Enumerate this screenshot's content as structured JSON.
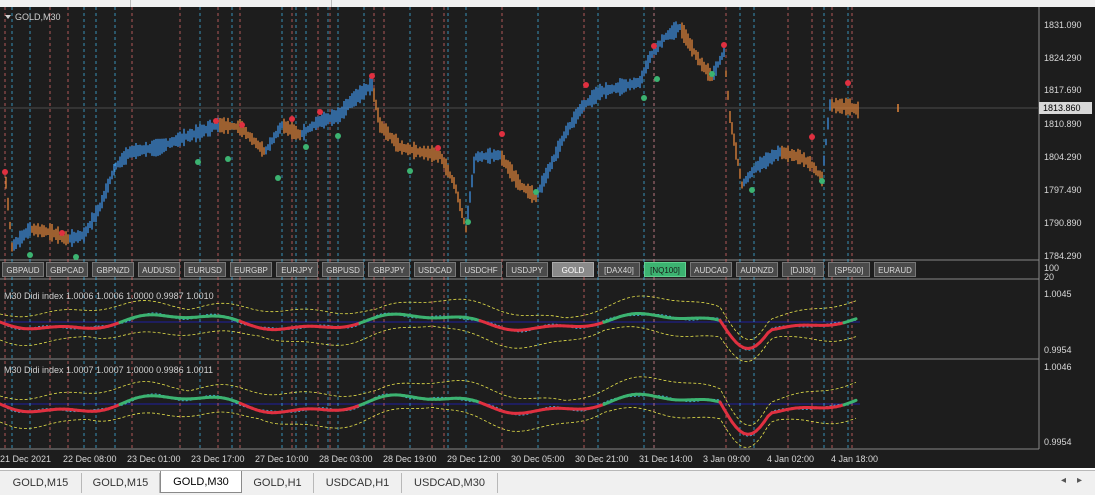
{
  "window": {
    "symbol_title": "GOLD,M30"
  },
  "price_axis": {
    "labels": [
      "1831.090",
      "1824.290",
      "1817.690",
      "1810.890",
      "1804.290",
      "1797.490",
      "1790.890",
      "1784.290"
    ],
    "current_price": "1813.860"
  },
  "symbol_buttons": [
    {
      "label": "GBPAUD",
      "state": "normal"
    },
    {
      "label": "GBPCAD",
      "state": "normal"
    },
    {
      "label": "GBPNZD",
      "state": "normal"
    },
    {
      "label": "AUDUSD",
      "state": "normal"
    },
    {
      "label": "EURUSD",
      "state": "normal"
    },
    {
      "label": "EURGBP",
      "state": "normal"
    },
    {
      "label": "EURJPY",
      "state": "normal"
    },
    {
      "label": "GBPUSD",
      "state": "normal"
    },
    {
      "label": "GBPJPY",
      "state": "normal"
    },
    {
      "label": "USDCAD",
      "state": "normal"
    },
    {
      "label": "USDCHF",
      "state": "normal"
    },
    {
      "label": "USDJPY",
      "state": "normal"
    },
    {
      "label": "GOLD",
      "state": "active"
    },
    {
      "label": "[DAX40]",
      "state": "normal"
    },
    {
      "label": "[NQ100]",
      "state": "green"
    },
    {
      "label": "AUDCAD",
      "state": "normal"
    },
    {
      "label": "AUDNZD",
      "state": "normal"
    },
    {
      "label": "[DJI30]",
      "state": "normal"
    },
    {
      "label": "[SP500]",
      "state": "normal"
    },
    {
      "label": "EURAUD",
      "state": "normal"
    }
  ],
  "mini_axis": {
    "top": "100",
    "bottom": "20"
  },
  "indicator1": {
    "title": "M30 Didi index 1.0006 1.0006 1.0000 0.9987 1.0010",
    "axis_top": "1.0045",
    "axis_bottom": "0.9954"
  },
  "indicator2": {
    "title": "M30 Didi index 1.0007 1.0007 1.0000 0.9986 1.0011",
    "axis_top": "1.0046",
    "axis_bottom": "0.9954"
  },
  "time_axis": [
    "21 Dec 2021",
    "22 Dec 08:00",
    "23 Dec 01:00",
    "23 Dec 17:00",
    "27 Dec 10:00",
    "28 Dec 03:00",
    "28 Dec 19:00",
    "29 Dec 12:00",
    "30 Dec 05:00",
    "30 Dec 21:00",
    "31 Dec 14:00",
    "3 Jan 09:00",
    "4 Jan 02:00",
    "4 Jan 18:00"
  ],
  "tabs": [
    {
      "label": "GOLD,M15",
      "active": false
    },
    {
      "label": "GOLD,M15",
      "active": false
    },
    {
      "label": "GOLD,M30",
      "active": true
    },
    {
      "label": "GOLD,H1",
      "active": false
    },
    {
      "label": "USDCAD,H1",
      "active": false
    },
    {
      "label": "USDCAD,M30",
      "active": false
    }
  ],
  "colors": {
    "background": "#1d1d1d",
    "bull": "#3f8fe0",
    "bear": "#e0843a",
    "signal_up": "#3cb371",
    "signal_down": "#e03040",
    "vline_blue": "#3fb6e8",
    "vline_red": "#e06a6a"
  }
}
